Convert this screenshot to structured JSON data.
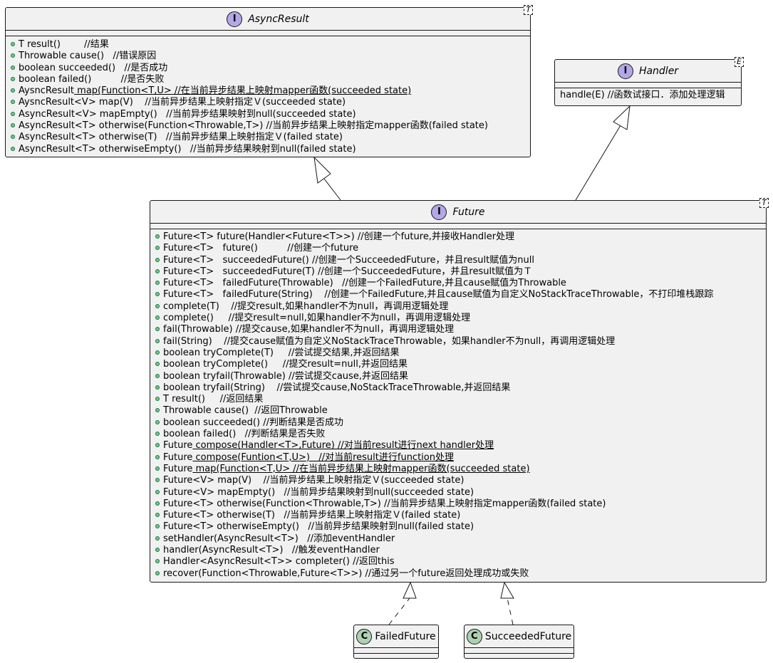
{
  "async_result": {
    "name": "AsyncResult",
    "stereotype": "I",
    "generic": "T",
    "methods": [
      {
        "pre": "T result()        //结果",
        "u": "",
        "post": ""
      },
      {
        "pre": "Throwable cause()   //错误原因",
        "u": "",
        "post": ""
      },
      {
        "pre": "boolean succeeded()   //是否成功",
        "u": "",
        "post": ""
      },
      {
        "pre": "boolean failed()          //是否失败",
        "u": "",
        "post": ""
      },
      {
        "pre": "AysncResult",
        "u": " map(Function<T,U> //在当前异步结果上映射mapper函数(succeeded state)",
        "post": ""
      },
      {
        "pre": "AysncResult<V> map(V)    //当前异步结果上映射指定Ｖ(succeeded state)",
        "u": "",
        "post": ""
      },
      {
        "pre": "AsyncResult<V> mapEmpty()   //当前异步结果映射到null(succeeded state)",
        "u": "",
        "post": ""
      },
      {
        "pre": "AsyncResult<T> otherwise(Function<Throwable,T>) //当前异步结果上映射指定mapper函数(failed state)",
        "u": "",
        "post": ""
      },
      {
        "pre": "AsyncResult<T> otherwise(T)   //当前异步结果上映射指定Ｖ(failed state)",
        "u": "",
        "post": ""
      },
      {
        "pre": "AsyncResult<T> otherwiseEmpty()   //当前异步结果映射到null(failed state)",
        "u": "",
        "post": ""
      }
    ]
  },
  "handler": {
    "name": "Handler",
    "stereotype": "I",
    "generic": "E",
    "methods": [
      {
        "pre": "handle(E) //函数试接口．添加处理逻辑",
        "u": "",
        "post": ""
      }
    ]
  },
  "future": {
    "name": "Future",
    "stereotype": "I",
    "generic": "T",
    "methods": [
      {
        "pre": "Future<T> future(Handler<Future<T>>) //创建一个future,并接收Handler处理",
        "u": "",
        "post": ""
      },
      {
        "pre": "Future<T>   future()          //创建一个future",
        "u": "",
        "post": ""
      },
      {
        "pre": "Future<T>   succeededFuture() //创建一个SucceededFuture，并且result赋值为null",
        "u": "",
        "post": ""
      },
      {
        "pre": "Future<T>   succeededFuture(T) //创建一个SucceededFuture，并且result赋值为Ｔ",
        "u": "",
        "post": ""
      },
      {
        "pre": "Future<T>   failedFuture(Throwable)   //创建一个FailedFuture,并且cause赋值为Throwable",
        "u": "",
        "post": ""
      },
      {
        "pre": "Future<T>   failedFuture(String)    //创建一个FailedFuture,并且cause赋值为自定义NoStackTraceThrowable，不打印堆栈跟踪",
        "u": "",
        "post": ""
      },
      {
        "pre": "complete(T)    //提交result,如果handler不为null，再调用逻辑处理",
        "u": "",
        "post": ""
      },
      {
        "pre": "complete()     //提交result=null,如果handler不为null，再调用逻辑处理",
        "u": "",
        "post": ""
      },
      {
        "pre": "fail(Throwable) //提交cause,如果handler不为null，再调用逻辑处理",
        "u": "",
        "post": ""
      },
      {
        "pre": "fail(String)    //提交cause赋值为自定义NoStackTraceThrowable，如果handler不为null，再调用逻辑处理",
        "u": "",
        "post": ""
      },
      {
        "pre": "boolean tryComplete(T)     //尝试提交结果,并返回结果",
        "u": "",
        "post": ""
      },
      {
        "pre": "boolean tryComplete()     //提交result=null,并返回结果",
        "u": "",
        "post": ""
      },
      {
        "pre": "boolean tryfail(Throwable) //尝试提交cause,并返回结果",
        "u": "",
        "post": ""
      },
      {
        "pre": "boolean tryfail(String)    //尝试提交cause,NoStackTraceThrowable,并返回结果",
        "u": "",
        "post": ""
      },
      {
        "pre": "T result()     //返回结果",
        "u": "",
        "post": ""
      },
      {
        "pre": "Throwable cause()  //返回Throwable",
        "u": "",
        "post": ""
      },
      {
        "pre": "boolean succeeded() //判断结果是否成功",
        "u": "",
        "post": ""
      },
      {
        "pre": "boolean failed()   //判断结果是否失败",
        "u": "",
        "post": ""
      },
      {
        "pre": "Future",
        "u": " compose(Handler<T>,Future) //对当前result进行next handler处理",
        "post": ""
      },
      {
        "pre": "Future",
        "u": " compose(Funtion<T,U>)   //对当前result进行function处理",
        "post": ""
      },
      {
        "pre": "Future",
        "u": " map(Function<T,U> //在当前异步结果上映射mapper函数(succeeded state)",
        "post": ""
      },
      {
        "pre": "Future<V> map(V)    //当前异步结果上映射指定Ｖ(succeeded state)",
        "u": "",
        "post": ""
      },
      {
        "pre": "Future<V> mapEmpty()   //当前异步结果映射到null(succeeded state)",
        "u": "",
        "post": ""
      },
      {
        "pre": "Future<T> otherwise(Function<Throwable,T>) //当前异步结果上映射指定mapper函数(failed state)",
        "u": "",
        "post": ""
      },
      {
        "pre": "Future<T> otherwise(T)   //当前异步结果上映射指定Ｖ(failed state)",
        "u": "",
        "post": ""
      },
      {
        "pre": "Future<T> otherwiseEmpty()   //当前异步结果映射到null(failed state)",
        "u": "",
        "post": ""
      },
      {
        "pre": "setHandler(AsyncResult<T>)   //添加eventHandler",
        "u": "",
        "post": ""
      },
      {
        "pre": "handler(AsyncResult<T>)   //触发eventHandler",
        "u": "",
        "post": ""
      },
      {
        "pre": "Handler<AsyncResult<T>> completer() //返回this",
        "u": "",
        "post": ""
      },
      {
        "pre": "recover(Function<Throwable,Future<T>>) //通过另一个future返回处理成功或失败",
        "u": "",
        "post": ""
      }
    ]
  },
  "failed_future": {
    "name": "FailedFuture",
    "stereotype": "C"
  },
  "succeeded_future": {
    "name": "SucceededFuture",
    "stereotype": "C"
  },
  "colors": {
    "class_fill": "#f1f1f1",
    "border": "#181818",
    "interface_spot": "#b4a7e5",
    "class_spot": "#add1b2",
    "public_dot": "#84be84"
  }
}
